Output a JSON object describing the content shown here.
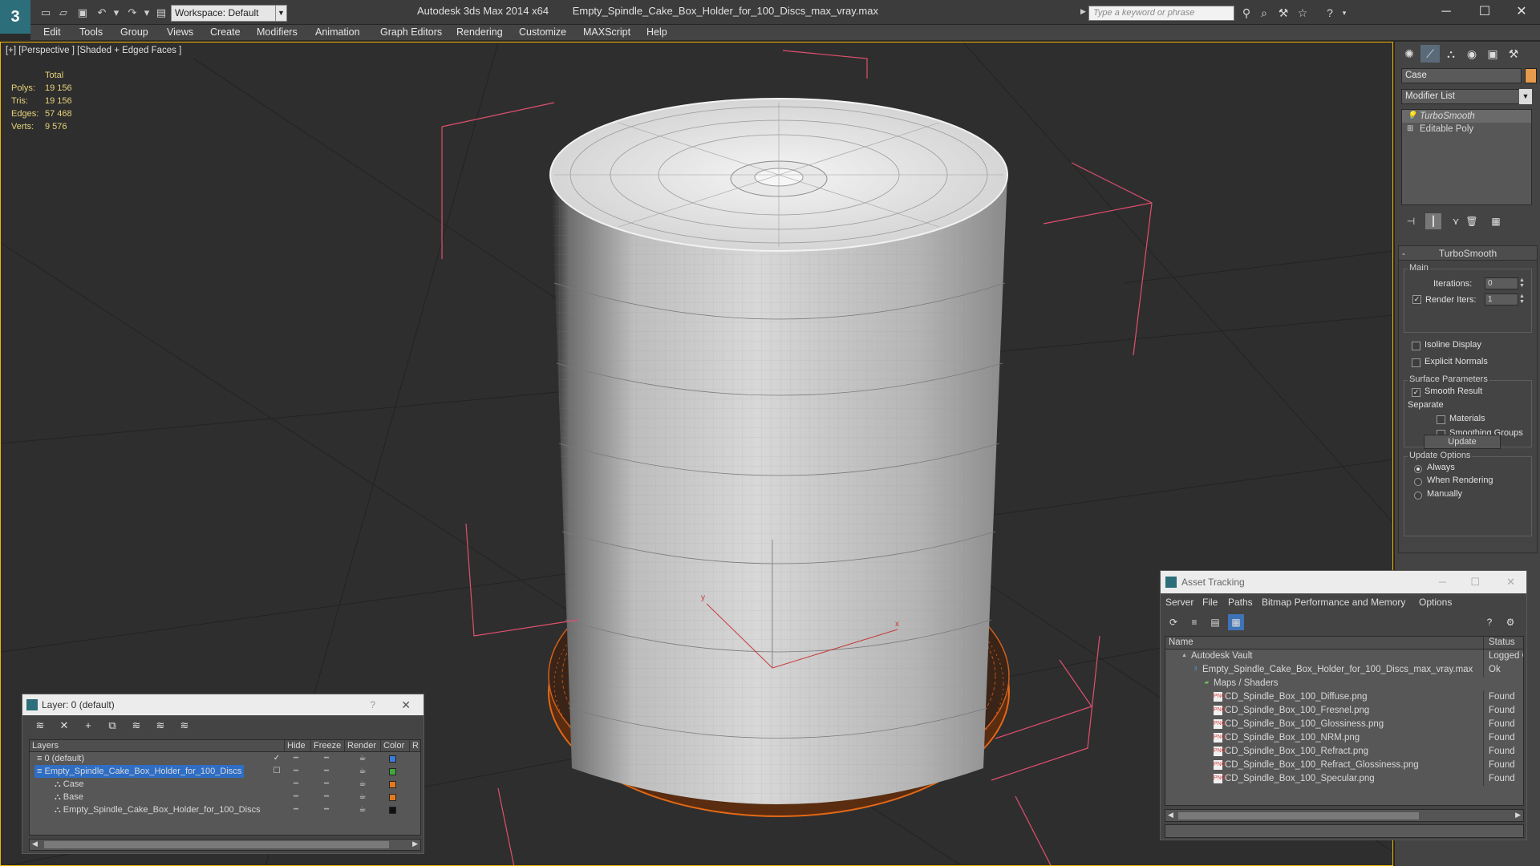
{
  "titlebar": {
    "app_title": "Autodesk 3ds Max 2014 x64",
    "file_title": "Empty_Spindle_Cake_Box_Holder_for_100_Discs_max_vray.max",
    "workspace": "Workspace: Default",
    "search_placeholder": "Type a keyword or phrase"
  },
  "menu": [
    "Edit",
    "Tools",
    "Group",
    "Views",
    "Create",
    "Modifiers",
    "Animation",
    "Graph Editors",
    "Rendering",
    "Customize",
    "MAXScript",
    "Help"
  ],
  "viewport": {
    "label": "[+] [Perspective ] [Shaded + Edged Faces ]",
    "stats": {
      "header": "Total",
      "rows": [
        {
          "label": "Polys:",
          "value": "19 156"
        },
        {
          "label": "Tris:",
          "value": "19 156"
        },
        {
          "label": "Edges:",
          "value": "57 468"
        },
        {
          "label": "Verts:",
          "value": "9 576"
        }
      ]
    },
    "gizmo_x": "x",
    "gizmo_y": "y"
  },
  "command_panel": {
    "object_name": "Case",
    "object_color": "#e89a4c",
    "modifier_list": "Modifier List",
    "stack": [
      "TurboSmooth",
      "Editable Poly"
    ],
    "rollout_title": "TurboSmooth",
    "main_label": "Main",
    "iterations_label": "Iterations:",
    "iterations_value": "0",
    "render_iters_label": "Render Iters:",
    "render_iters_value": "1",
    "isoline_label": "Isoline Display",
    "explicit_normals_label": "Explicit Normals",
    "surface_params_label": "Surface Parameters",
    "smooth_result_label": "Smooth Result",
    "separate_label": "Separate",
    "materials_label": "Materials",
    "smoothing_groups_label": "Smoothing Groups",
    "update_options_label": "Update Options",
    "always_label": "Always",
    "when_rendering_label": "When Rendering",
    "manually_label": "Manually",
    "update_button": "Update"
  },
  "layer_dialog": {
    "title": "Layer: 0 (default)",
    "help": "?",
    "columns": [
      "Layers",
      "Hide",
      "Freeze",
      "Render",
      "Color",
      "R"
    ],
    "rows": [
      {
        "name": "0 (default)",
        "indent": 1,
        "color": "#3b7bd6",
        "selected": false,
        "check": "✓"
      },
      {
        "name": "Empty_Spindle_Cake_Box_Holder_for_100_Discs",
        "indent": 1,
        "color": "#3ea83e",
        "selected": true,
        "check": "☐"
      },
      {
        "name": "Case",
        "indent": 2,
        "color": "#e07a20",
        "selected": false,
        "check": ""
      },
      {
        "name": "Base",
        "indent": 2,
        "color": "#e07a20",
        "selected": false,
        "check": ""
      },
      {
        "name": "Empty_Spindle_Cake_Box_Holder_for_100_Discs",
        "indent": 2,
        "color": "#111111",
        "selected": false,
        "check": ""
      }
    ]
  },
  "asset_dialog": {
    "title": "Asset Tracking",
    "menu": [
      "Server",
      "File",
      "Paths",
      "Bitmap Performance and Memory",
      "Options"
    ],
    "col_name": "Name",
    "col_status": "Status",
    "rows": [
      {
        "name": "Autodesk Vault",
        "indent": 1,
        "status": "Logged O",
        "type": "vault"
      },
      {
        "name": "Empty_Spindle_Cake_Box_Holder_for_100_Discs_max_vray.max",
        "indent": 2,
        "status": "Ok",
        "type": "max"
      },
      {
        "name": "Maps / Shaders",
        "indent": 3,
        "status": "",
        "type": "folder"
      },
      {
        "name": "CD_Spindle_Box_100_Diffuse.png",
        "indent": 4,
        "status": "Found",
        "type": "png"
      },
      {
        "name": "CD_Spindle_Box_100_Fresnel.png",
        "indent": 4,
        "status": "Found",
        "type": "png"
      },
      {
        "name": "CD_Spindle_Box_100_Glossiness.png",
        "indent": 4,
        "status": "Found",
        "type": "png"
      },
      {
        "name": "CD_Spindle_Box_100_NRM.png",
        "indent": 4,
        "status": "Found",
        "type": "png"
      },
      {
        "name": "CD_Spindle_Box_100_Refract.png",
        "indent": 4,
        "status": "Found",
        "type": "png"
      },
      {
        "name": "CD_Spindle_Box_100_Refract_Glossiness.png",
        "indent": 4,
        "status": "Found",
        "type": "png"
      },
      {
        "name": "CD_Spindle_Box_100_Specular.png",
        "indent": 4,
        "status": "Found",
        "type": "png"
      }
    ]
  }
}
